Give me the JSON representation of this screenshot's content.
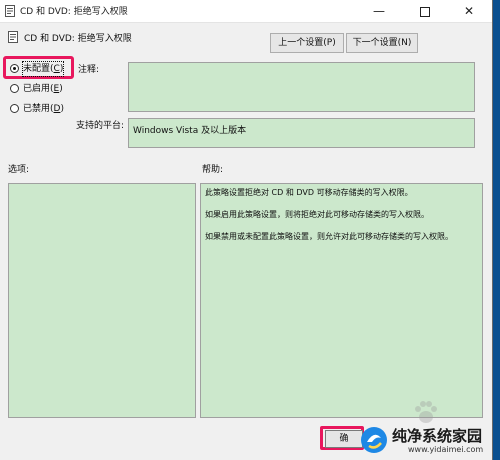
{
  "window": {
    "title": "CD 和 DVD: 拒绝写入权限",
    "controls": {
      "minimize": "—",
      "close": "✕"
    }
  },
  "header": {
    "policy_name": "CD 和 DVD: 拒绝写入权限",
    "prev_button": "上一个设置(P)",
    "next_button": "下一个设置(N)"
  },
  "radios": [
    {
      "label": "未配置(",
      "hotkey": "C",
      "close": ")",
      "checked": true
    },
    {
      "label": "已启用(",
      "hotkey": "E",
      "close": ")",
      "checked": false
    },
    {
      "label": "已禁用(",
      "hotkey": "D",
      "close": ")",
      "checked": false
    }
  ],
  "fields": {
    "comment_label": "注释:",
    "comment_value": "",
    "platform_label": "支持的平台:",
    "platform_value": "Windows Vista 及以上版本"
  },
  "sections": {
    "options_label": "选项:",
    "help_label": "帮助:"
  },
  "help_text": [
    "此策略设置拒绝对 CD 和 DVD 可移动存储类的写入权限。",
    "如果启用此策略设置，则将拒绝对此可移动存储类的写入权限。",
    "如果禁用或未配置此策略设置，则允许对此可移动存储类的写入权限。"
  ],
  "footer": {
    "ok_button": "确"
  },
  "watermark": {
    "text": "纯净系统家园",
    "url": "www.yidaimei.com"
  },
  "colors": {
    "highlight": "#e8175d",
    "green_panel": "#cce8cc",
    "desktop": "#0a4f8f"
  }
}
